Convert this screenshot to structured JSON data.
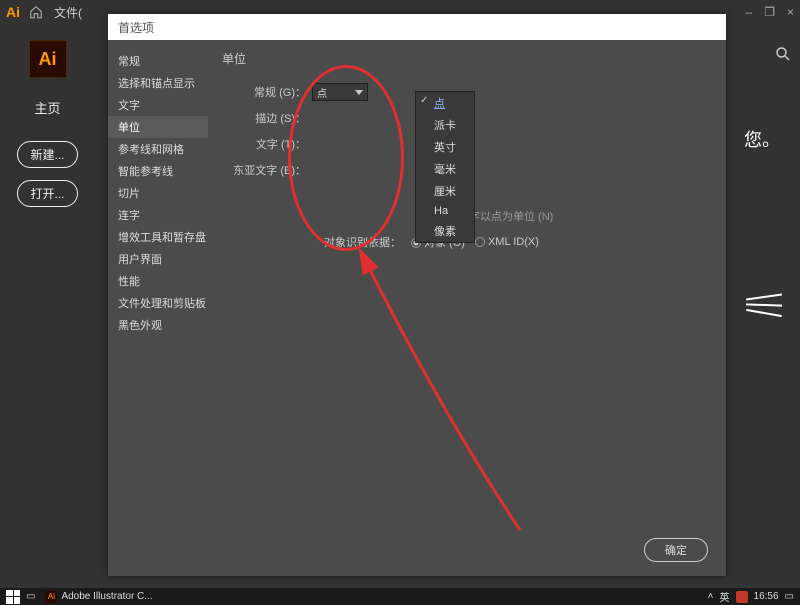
{
  "menubar": {
    "ai": "Ai",
    "file": "文件(",
    "window_min": "–",
    "window_restore": "❐",
    "window_close": "×"
  },
  "left_rail": {
    "home": "主页",
    "new_btn": "新建...",
    "open_btn": "打开..."
  },
  "dialog": {
    "title": "首选项",
    "sidebar": [
      "常规",
      "选择和锚点显示",
      "文字",
      "单位",
      "参考线和网格",
      "智能参考线",
      "切片",
      "连字",
      "增效工具和暂存盘",
      "用户界面",
      "性能",
      "文件处理和剪贴板",
      "黑色外观"
    ],
    "selected_index": 3,
    "section_title": "单位",
    "rows": {
      "general": "常规 (G)：",
      "stroke": "描边 (S)：",
      "type": "文字 (T)：",
      "asian": "东亚文字 (E)："
    },
    "dropdown_value": "点",
    "dropdown_items": [
      "点",
      "派卡",
      "英寸",
      "毫米",
      "厘米",
      "Ha",
      "像素"
    ],
    "checked_index": 0,
    "hint_text": "数字以点为单位 (N)",
    "obj_id_label": "对象识别依据：",
    "radio1": "对象 (O)",
    "radio2": "XML ID(X)",
    "ok": "确定"
  },
  "right": {
    "text": "您。"
  },
  "taskbar": {
    "app": "Adobe Illustrator C...",
    "ime": "英",
    "time": "16:56"
  }
}
